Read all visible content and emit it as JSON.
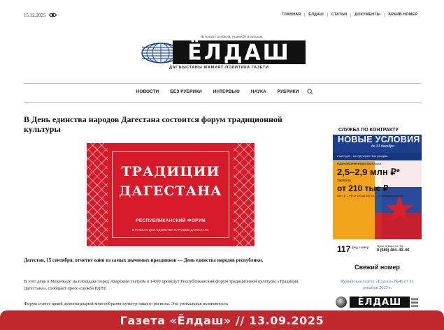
{
  "header": {
    "date": "15.12.2025",
    "top_nav": [
      "ГЛАВНАЯ",
      "ЁЛДАШ",
      "СТАТЬИ",
      "ДОКУМЕНТЫ",
      "АРХИВ НОМЕР"
    ]
  },
  "logo": {
    "tagline": "Ассаламу алейкум, уьмюкде языльлык",
    "name": "ЁЛДАШ",
    "subtitle": "ДАГЪЫСТАНЫ ЖАМИЯТ-ПОЛИТИКА ГАЗЕТИ"
  },
  "main_nav": [
    "НОВОСТИ",
    "БЕЗ РУБРИКИ",
    "ИНТЕРВЬЮ",
    "НАУКА",
    "РУБРИКИ"
  ],
  "article": {
    "title": "В День единства народов Дагестана состоится форум традиционной культуры",
    "banner": {
      "line1": "ТРАДИЦИИ",
      "line2": "ДАГЕСТАНА",
      "line3": "РЕСПУБЛИКАНСКИЙ ФОРУМ",
      "line4": "В РАМКАХ ДНЯ ЕДИНСТВА НАРОДОВ ДАГЕСТАНА"
    },
    "lead": "Дагестан, 15 сентября, отметит один из самых значимых праздников — День единства народов республики.",
    "p1": "В этот день в Махачкале на площадке перед Аварским театром в 14:00 проведут Республиканский форум традиционной культуры «Традиции Дагестана», сообщает пресс-служба РДНТ.",
    "p2": "Форум станет яркой демонстрацией многообразия культур нашего региона. Это уникальная возможность"
  },
  "sidebar": {
    "ad": {
      "service": "СЛУЖБА ПО КОНТРАКТУ",
      "headline": "НОВЫЕ УСЛОВИЯ",
      "deadline": "до 31 декабря",
      "note": "2 млн руб. - от ПД через Пот резерва",
      "bonus_label": "Единовременная выплата",
      "bonus_value": "2,5–2,9 млн ₽*",
      "salary_label": "Зарплата",
      "salary_value": "от 210 тыс ₽",
      "fine_print": "400 т.р. – РФ от 100 до 200 т.р. – от муниципалитетов",
      "number": "117",
      "number_label": "фед. номер",
      "phone_label": "Пункт отбора по ПД",
      "phone": "8 (989) 484–49–95"
    },
    "fresh_title": "Свежий номер",
    "fresh_link": "Кумыкская газета «Ёлдаш» №46 от 11 декабря 2025 г.",
    "mini_logo": "ЁЛДАШ"
  },
  "caption": "Газета «Ёлдаш» // 13.09.2025",
  "colors": {
    "banner_red": "#d71a2a",
    "caption_red": "#c1272d",
    "ad_blue": "#1b3e8f",
    "link_blue": "#4d79c7"
  }
}
